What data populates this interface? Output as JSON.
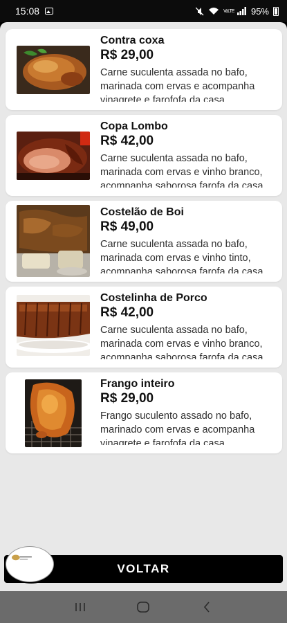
{
  "status_bar": {
    "time": "15:08",
    "network": "VoLTE",
    "battery": "95%",
    "icons": [
      "image-icon",
      "mute-icon",
      "wifi-icon",
      "signal-icon",
      "battery-icon"
    ]
  },
  "menu": {
    "items": [
      {
        "name": "Contra coxa",
        "price": "R$ 29,00",
        "description": "Carne suculenta assada no bafo, marinada com ervas e acompanha vinagrete e farofofa da casa",
        "image_icon": "roast-chicken-thigh"
      },
      {
        "name": "Copa Lombo",
        "price": "R$ 42,00",
        "description": "Carne suculenta assada no bafo, marinada com ervas e vinho branco, acompanha saborosa farofa da casa",
        "image_icon": "roast-pork-loin"
      },
      {
        "name": "Costelão de Boi",
        "price": "R$ 49,00",
        "description": "Carne suculenta assada no bafo, marinada com ervas e vinho tinto, acompanha saborosa farofa da casa",
        "image_icon": "beef-ribs"
      },
      {
        "name": "Costelinha de Porco",
        "price": "R$ 42,00",
        "description": "Carne suculenta assada no bafo, marinada com ervas e vinho branco, acompanha saborosa farofa da casa",
        "image_icon": "pork-ribs"
      },
      {
        "name": "Frango inteiro",
        "price": "R$ 29,00",
        "description": "Frango suculento assado no bafo, marinado com ervas e acompanha vinagrete e farofofa da casa",
        "image_icon": "whole-roast-chicken"
      }
    ]
  },
  "footer": {
    "back_label": "VOLTAR"
  },
  "colors": {
    "background": "#e8e8e8",
    "card": "#ffffff",
    "back_button": "#000000",
    "nav_bar": "#6b6b6b"
  }
}
